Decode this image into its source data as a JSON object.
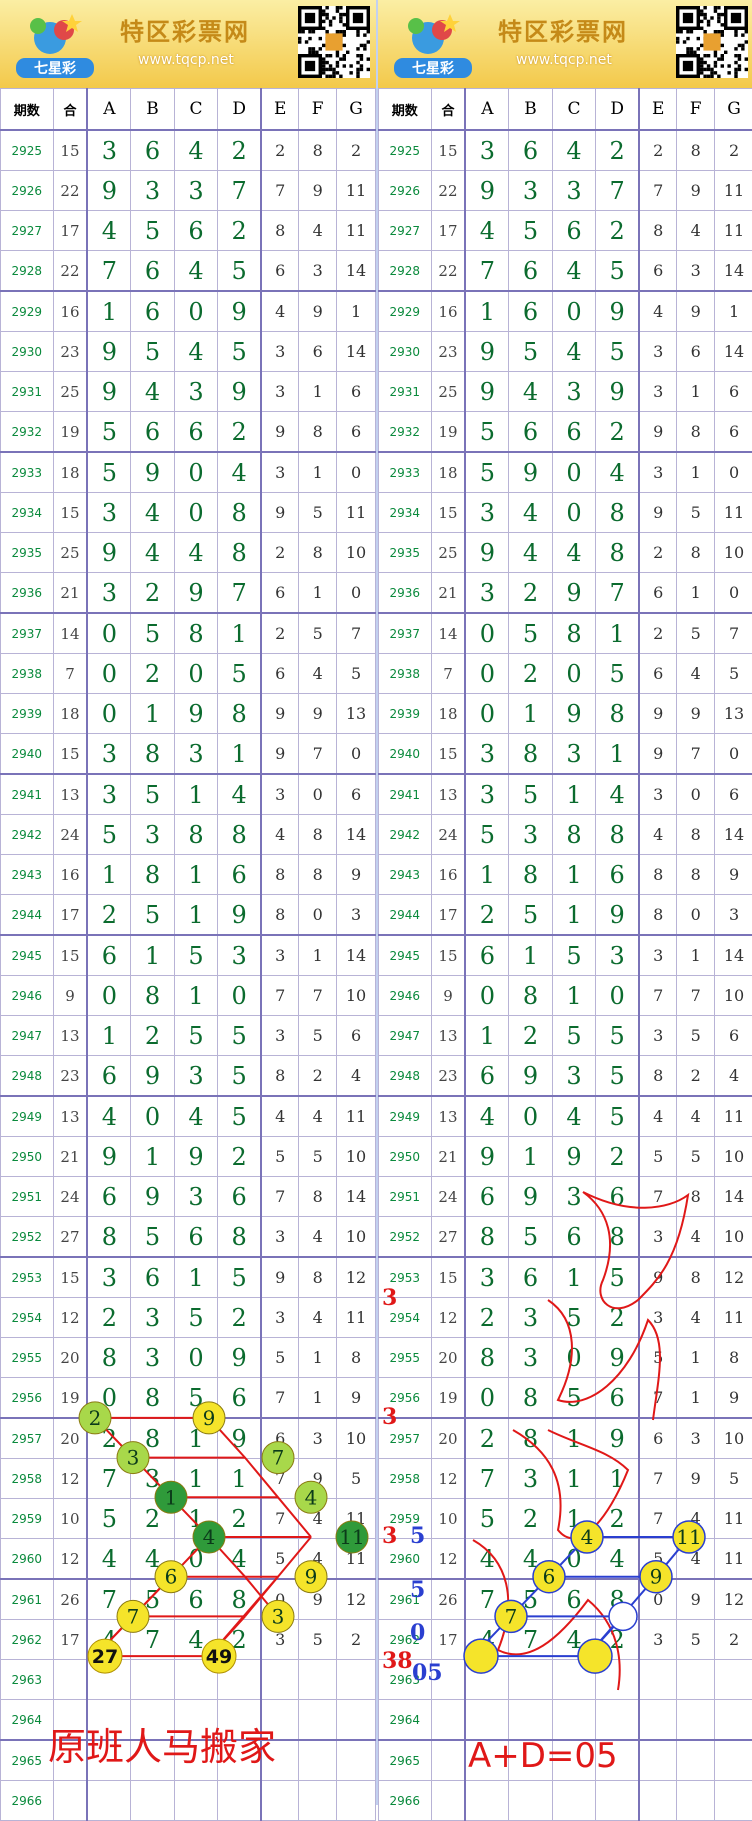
{
  "banner": {
    "title": "特区彩票网",
    "url": "www.tqcp.net",
    "logo_text": "七星彩"
  },
  "headers": [
    "期数",
    "合",
    "A",
    "B",
    "C",
    "D",
    "E",
    "F",
    "G"
  ],
  "rows": [
    {
      "issue": "2925",
      "sum": "15",
      "a": "3",
      "b": "6",
      "c": "4",
      "d": "2",
      "e": "2",
      "f": "8",
      "g": "2"
    },
    {
      "issue": "2926",
      "sum": "22",
      "a": "9",
      "b": "3",
      "c": "3",
      "d": "7",
      "e": "7",
      "f": "9",
      "g": "11"
    },
    {
      "issue": "2927",
      "sum": "17",
      "a": "4",
      "b": "5",
      "c": "6",
      "d": "2",
      "e": "8",
      "f": "4",
      "g": "11"
    },
    {
      "issue": "2928",
      "sum": "22",
      "a": "7",
      "b": "6",
      "c": "4",
      "d": "5",
      "e": "6",
      "f": "3",
      "g": "14"
    },
    {
      "issue": "2929",
      "sum": "16",
      "a": "1",
      "b": "6",
      "c": "0",
      "d": "9",
      "e": "4",
      "f": "9",
      "g": "1"
    },
    {
      "issue": "2930",
      "sum": "23",
      "a": "9",
      "b": "5",
      "c": "4",
      "d": "5",
      "e": "3",
      "f": "6",
      "g": "14"
    },
    {
      "issue": "2931",
      "sum": "25",
      "a": "9",
      "b": "4",
      "c": "3",
      "d": "9",
      "e": "3",
      "f": "1",
      "g": "6"
    },
    {
      "issue": "2932",
      "sum": "19",
      "a": "5",
      "b": "6",
      "c": "6",
      "d": "2",
      "e": "9",
      "f": "8",
      "g": "6"
    },
    {
      "issue": "2933",
      "sum": "18",
      "a": "5",
      "b": "9",
      "c": "0",
      "d": "4",
      "e": "3",
      "f": "1",
      "g": "0"
    },
    {
      "issue": "2934",
      "sum": "15",
      "a": "3",
      "b": "4",
      "c": "0",
      "d": "8",
      "e": "9",
      "f": "5",
      "g": "11"
    },
    {
      "issue": "2935",
      "sum": "25",
      "a": "9",
      "b": "4",
      "c": "4",
      "d": "8",
      "e": "2",
      "f": "8",
      "g": "10"
    },
    {
      "issue": "2936",
      "sum": "21",
      "a": "3",
      "b": "2",
      "c": "9",
      "d": "7",
      "e": "6",
      "f": "1",
      "g": "0"
    },
    {
      "issue": "2937",
      "sum": "14",
      "a": "0",
      "b": "5",
      "c": "8",
      "d": "1",
      "e": "2",
      "f": "5",
      "g": "7"
    },
    {
      "issue": "2938",
      "sum": "7",
      "a": "0",
      "b": "2",
      "c": "0",
      "d": "5",
      "e": "6",
      "f": "4",
      "g": "5"
    },
    {
      "issue": "2939",
      "sum": "18",
      "a": "0",
      "b": "1",
      "c": "9",
      "d": "8",
      "e": "9",
      "f": "9",
      "g": "13"
    },
    {
      "issue": "2940",
      "sum": "15",
      "a": "3",
      "b": "8",
      "c": "3",
      "d": "1",
      "e": "9",
      "f": "7",
      "g": "0"
    },
    {
      "issue": "2941",
      "sum": "13",
      "a": "3",
      "b": "5",
      "c": "1",
      "d": "4",
      "e": "3",
      "f": "0",
      "g": "6"
    },
    {
      "issue": "2942",
      "sum": "24",
      "a": "5",
      "b": "3",
      "c": "8",
      "d": "8",
      "e": "4",
      "f": "8",
      "g": "14"
    },
    {
      "issue": "2943",
      "sum": "16",
      "a": "1",
      "b": "8",
      "c": "1",
      "d": "6",
      "e": "8",
      "f": "8",
      "g": "9"
    },
    {
      "issue": "2944",
      "sum": "17",
      "a": "2",
      "b": "5",
      "c": "1",
      "d": "9",
      "e": "8",
      "f": "0",
      "g": "3"
    },
    {
      "issue": "2945",
      "sum": "15",
      "a": "6",
      "b": "1",
      "c": "5",
      "d": "3",
      "e": "3",
      "f": "1",
      "g": "14"
    },
    {
      "issue": "2946",
      "sum": "9",
      "a": "0",
      "b": "8",
      "c": "1",
      "d": "0",
      "e": "7",
      "f": "7",
      "g": "10"
    },
    {
      "issue": "2947",
      "sum": "13",
      "a": "1",
      "b": "2",
      "c": "5",
      "d": "5",
      "e": "3",
      "f": "5",
      "g": "6"
    },
    {
      "issue": "2948",
      "sum": "23",
      "a": "6",
      "b": "9",
      "c": "3",
      "d": "5",
      "e": "8",
      "f": "2",
      "g": "4"
    },
    {
      "issue": "2949",
      "sum": "13",
      "a": "4",
      "b": "0",
      "c": "4",
      "d": "5",
      "e": "4",
      "f": "4",
      "g": "11"
    },
    {
      "issue": "2950",
      "sum": "21",
      "a": "9",
      "b": "1",
      "c": "9",
      "d": "2",
      "e": "5",
      "f": "5",
      "g": "10"
    },
    {
      "issue": "2951",
      "sum": "24",
      "a": "6",
      "b": "9",
      "c": "3",
      "d": "6",
      "e": "7",
      "f": "8",
      "g": "14"
    },
    {
      "issue": "2952",
      "sum": "27",
      "a": "8",
      "b": "5",
      "c": "6",
      "d": "8",
      "e": "3",
      "f": "4",
      "g": "10"
    },
    {
      "issue": "2953",
      "sum": "15",
      "a": "3",
      "b": "6",
      "c": "1",
      "d": "5",
      "e": "9",
      "f": "8",
      "g": "12"
    },
    {
      "issue": "2954",
      "sum": "12",
      "a": "2",
      "b": "3",
      "c": "5",
      "d": "2",
      "e": "3",
      "f": "4",
      "g": "11"
    },
    {
      "issue": "2955",
      "sum": "20",
      "a": "8",
      "b": "3",
      "c": "0",
      "d": "9",
      "e": "5",
      "f": "1",
      "g": "8"
    },
    {
      "issue": "2956",
      "sum": "19",
      "a": "0",
      "b": "8",
      "c": "5",
      "d": "6",
      "e": "7",
      "f": "1",
      "g": "9"
    },
    {
      "issue": "2957",
      "sum": "20",
      "a": "2",
      "b": "8",
      "c": "1",
      "d": "9",
      "e": "6",
      "f": "3",
      "g": "10"
    },
    {
      "issue": "2958",
      "sum": "12",
      "a": "7",
      "b": "3",
      "c": "1",
      "d": "1",
      "e": "7",
      "f": "9",
      "g": "5"
    },
    {
      "issue": "2959",
      "sum": "10",
      "a": "5",
      "b": "2",
      "c": "1",
      "d": "2",
      "e": "7",
      "f": "4",
      "g": "11"
    },
    {
      "issue": "2960",
      "sum": "12",
      "a": "4",
      "b": "4",
      "c": "0",
      "d": "4",
      "e": "5",
      "f": "4",
      "g": "11"
    },
    {
      "issue": "2961",
      "sum": "26",
      "a": "7",
      "b": "5",
      "c": "6",
      "d": "8",
      "e": "0",
      "f": "9",
      "g": "12"
    },
    {
      "issue": "2962",
      "sum": "17",
      "a": "4",
      "b": "7",
      "c": "4",
      "d": "2",
      "e": "3",
      "f": "5",
      "g": "2"
    },
    {
      "issue": "2963",
      "sum": "",
      "a": "",
      "b": "",
      "c": "",
      "d": "",
      "e": "",
      "f": "",
      "g": ""
    },
    {
      "issue": "2964",
      "sum": "",
      "a": "",
      "b": "",
      "c": "",
      "d": "",
      "e": "",
      "f": "",
      "g": ""
    },
    {
      "issue": "2965",
      "sum": "",
      "a": "",
      "b": "",
      "c": "",
      "d": "",
      "e": "",
      "f": "",
      "g": ""
    },
    {
      "issue": "2966",
      "sum": "",
      "a": "",
      "b": "",
      "c": "",
      "d": "",
      "e": "",
      "f": "",
      "g": ""
    }
  ],
  "left_annotations": {
    "pred_a": "27",
    "pred_d": "49",
    "caption": "原班人马搬家"
  },
  "right_annotations": {
    "marks": [
      "3",
      "3",
      "3",
      "5",
      "5",
      "0",
      "38",
      "05"
    ],
    "caption": "A+D=05"
  },
  "colors": {
    "issue": "#0a8a3c",
    "main": "#0b6b2e",
    "red": "#e01818",
    "blue": "#2a3fd0",
    "yellow": "#f5e42a",
    "green": "#2f9a3a",
    "lightgreen": "#a8d84a"
  }
}
